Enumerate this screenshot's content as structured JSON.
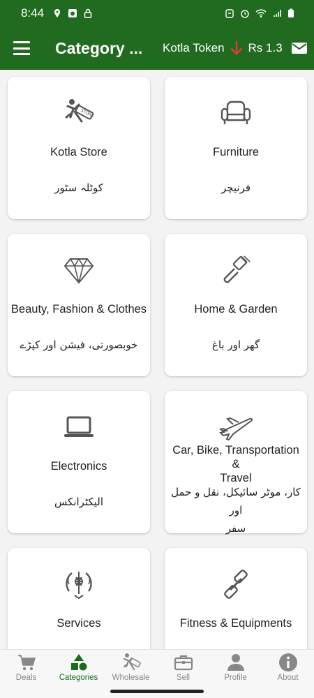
{
  "status_bar": {
    "time": "8:44"
  },
  "app_bar": {
    "title": "Category ...",
    "token_label": "Kotla Token",
    "token_value": "Rs 1.3"
  },
  "categories": [
    {
      "title": "Kotla Store",
      "urdu": "کوٹلہ سٹور",
      "icon": "kotla-store-icon"
    },
    {
      "title": "Furniture",
      "urdu": "فرنیچر",
      "icon": "armchair-icon"
    },
    {
      "title": "Beauty, Fashion & Clothes",
      "urdu": "خوبصورتی، فیشن اور کپڑے",
      "icon": "diamond-icon"
    },
    {
      "title": "Home & Garden",
      "urdu": "گھر اور باغ",
      "icon": "paint-brush-icon"
    },
    {
      "title": "Electronics",
      "urdu": "الیکٹرانکس",
      "icon": "laptop-icon"
    },
    {
      "title_line1": "Car, Bike, Transportation &",
      "title_line2": "Travel",
      "urdu_line1": "کار، موٹر سائیکل، نقل و حمل اور",
      "urdu_line2": "سفر",
      "icon": "airplane-icon"
    },
    {
      "title": "Services",
      "icon": "services-emblem-icon"
    },
    {
      "title": "Fitness & Equipments",
      "icon": "dumbbell-icon"
    }
  ],
  "bottom_nav": [
    {
      "label": "Deals",
      "icon": "cart-icon",
      "active": false
    },
    {
      "label": "Categories",
      "icon": "categories-icon",
      "active": true
    },
    {
      "label": "Wholesale",
      "icon": "wholesale-icon",
      "active": false
    },
    {
      "label": "Sell",
      "icon": "briefcase-icon",
      "active": false
    },
    {
      "label": "Profile",
      "icon": "person-icon",
      "active": false
    },
    {
      "label": "About",
      "icon": "info-icon",
      "active": false
    }
  ],
  "colors": {
    "primary": "#216b21",
    "active_nav": "#1e6b1e",
    "down_arrow": "#e53935"
  }
}
